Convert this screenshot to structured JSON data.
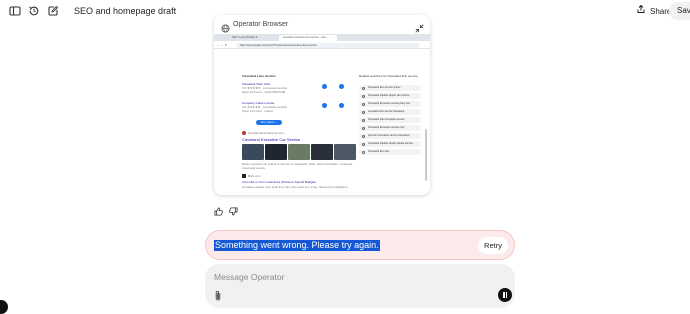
{
  "topbar": {
    "title": "SEO and homepage draft",
    "share_label": "Share",
    "save_label": "Save",
    "icons": [
      "sidebar-toggle-icon",
      "history-icon",
      "edit-icon",
      "share-icon"
    ]
  },
  "browser": {
    "name": "Operator Browser",
    "tabs": [
      "SEO / Local Visibility & ...",
      "cleveland executive limo service - Goo..."
    ],
    "address": "https://www.google.com/search?q=cleveland+executive+limo+service",
    "local_pack": {
      "heading": "Cleveland Limo Service",
      "places": [
        {
          "name": "Cleveland Town Cars",
          "meta": "5.0 ★★★★★ · Limousine service",
          "detail": "Open 24 hours · (216) 555-0198"
        },
        {
          "name": "Company Cards Livonia",
          "meta": "4.9 ★★★★★ · Limousine service",
          "detail": "Open 24 hours · Listed"
        }
      ],
      "more_label": "More places →"
    },
    "result1": {
      "site": "clevelandexecutivecar.com",
      "title": "Cleveland Executive Car Service",
      "snippet": "Book executive car and limo service in Cleveland, Ohio. Airport transfers, corporate travel and events."
    },
    "result2": {
      "site": "Bark.com",
      "title": "Limo Hire in Your Local Area | Prices to Suit All Budgets",
      "snippet": "Compare quotes from local limo hire pros near you. Free, fast and no obligation."
    },
    "related_heading": "Related searches for Cleveland limo service",
    "related": [
      "Cleveland limo service prices",
      "Cleveland hopkins airport taxi service",
      "Cleveland limousine service party bus",
      "cleveland limo service Cleveland",
      "Cleveland ohio limousine service",
      "Cleveland limousine service cost",
      "premium limousine service Cleveland",
      "Cleveland hopkins airport shuttle service",
      "Cleveland limo bus"
    ]
  },
  "feedback": {
    "icons": [
      "thumbs-up-icon",
      "thumbs-down-icon"
    ]
  },
  "error": {
    "message": "Something went wrong. Please try again.",
    "retry_label": "Retry"
  },
  "composer": {
    "placeholder": "Message Operator",
    "icons": [
      "paperclip-icon",
      "stop-icon"
    ]
  },
  "colors": {
    "error_bg": "#fdeaea",
    "selection": "#1558d6",
    "link_blue": "#1a0dab",
    "accent": "#1a73e8"
  }
}
